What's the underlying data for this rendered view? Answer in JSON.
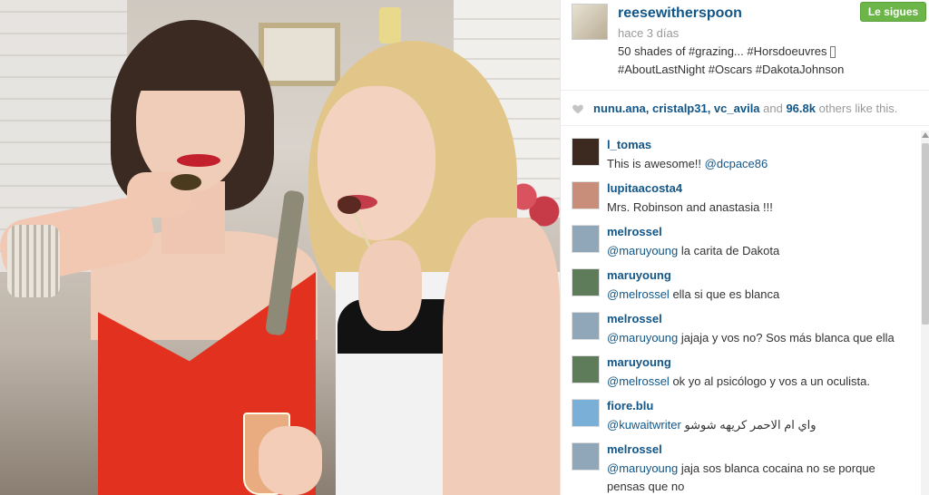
{
  "post": {
    "username": "reesewitherspoon",
    "time": "hace 3 días",
    "caption_line1": "50 shades of #grazing... #Horsdoeuvres ",
    "caption_line2": "#AboutLastNight #Oscars #DakotaJohnson",
    "follow_label": "Le sigues"
  },
  "likes": {
    "users": "nunu.ana, cristalp31, vc_avila",
    "connector": " and ",
    "count": "96.8k",
    "suffix": " others like this."
  },
  "comments": [
    {
      "user": "l_tomas",
      "text": "This is awesome!! ",
      "mention": "@dcpace86",
      "text_after": "",
      "avatar_color": "#3c2a20"
    },
    {
      "user": "lupitaacosta4",
      "text": "Mrs. Robinson and anastasia !!!",
      "mention": "",
      "text_after": "",
      "avatar_color": "#c98e7a"
    },
    {
      "user": "melrossel",
      "text": "",
      "mention": "@maruyoung",
      "text_after": " la carita de Dakota",
      "avatar_color": "#8fa7b8"
    },
    {
      "user": "maruyoung",
      "text": "",
      "mention": "@melrossel",
      "text_after": " ella si que es blanca",
      "avatar_color": "#5e7c5a"
    },
    {
      "user": "melrossel",
      "text": "",
      "mention": "@maruyoung",
      "text_after": " jajaja y vos no? Sos más blanca que ella",
      "avatar_color": "#8fa7b8"
    },
    {
      "user": "maruyoung",
      "text": "",
      "mention": "@melrossel",
      "text_after": " ok yo al psicólogo y vos a un oculista.",
      "avatar_color": "#5e7c5a"
    },
    {
      "user": "fiore.blu",
      "text": "",
      "mention": "@kuwaitwriter",
      "text_after": " واي ام الاحمر كريهه شوشو",
      "avatar_color": "#7ab0d8"
    },
    {
      "user": "melrossel",
      "text": "",
      "mention": "@maruyoung",
      "text_after": " jaja sos blanca cocaina no se porque pensas que no",
      "avatar_color": "#8fa7b8"
    }
  ],
  "colors": {
    "link": "#125688",
    "follow": "#6bb549"
  }
}
